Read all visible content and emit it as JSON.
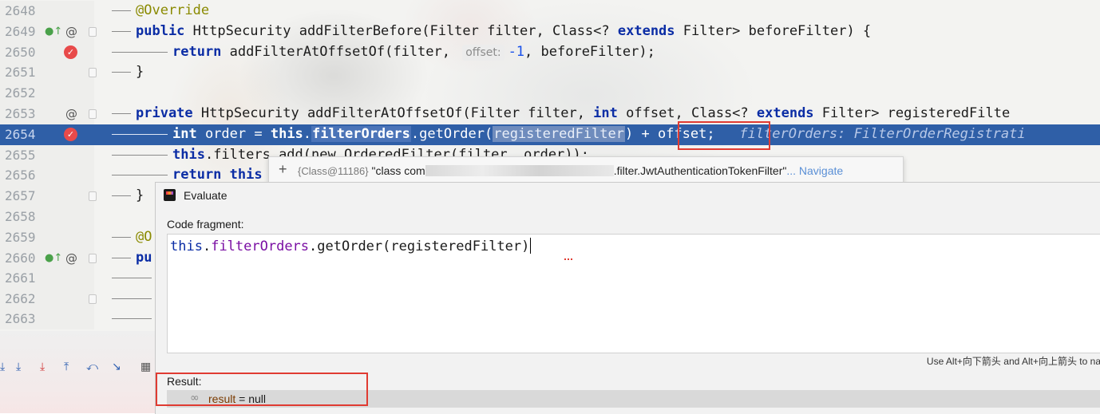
{
  "editor": {
    "lines": [
      {
        "num": "2648"
      },
      {
        "num": "2649",
        "override_marker": true,
        "at_marker": true
      },
      {
        "num": "2650",
        "breakpoint": true
      },
      {
        "num": "2651"
      },
      {
        "num": "2652"
      },
      {
        "num": "2653",
        "at_marker": true
      },
      {
        "num": "2654",
        "breakpoint": true,
        "selected": true
      },
      {
        "num": "2655"
      },
      {
        "num": "2656"
      },
      {
        "num": "2657"
      },
      {
        "num": "2658"
      },
      {
        "num": "2659"
      },
      {
        "num": "2660",
        "override_marker": true,
        "at_marker": true
      },
      {
        "num": "2661"
      },
      {
        "num": "2662"
      },
      {
        "num": "2663"
      }
    ],
    "code": {
      "l2648_ann": "@Override",
      "l2649_kw": "public",
      "l2649_rest": " HttpSecurity addFilterBefore(Filter filter, Class<? ",
      "l2649_kw2": "extends",
      "l2649_rest2": " Filter> beforeFilter) {",
      "l2650_kw": "return",
      "l2650_a": " addFilterAtOffsetOf(filter, ",
      "l2650_hint": "offset:",
      "l2650_num": "-1",
      "l2650_b": ", beforeFilter);",
      "l2651": "}",
      "l2653_kw": "private",
      "l2653_a": " HttpSecurity addFilterAtOffsetOf(Filter filter, ",
      "l2653_kw2": "int",
      "l2653_b": " offset, Class<? ",
      "l2653_kw3": "extends",
      "l2653_c": " Filter> registeredFilte",
      "l2654_kw": "int",
      "l2654_a": " order = ",
      "l2654_this": "this",
      "l2654_dot": ".",
      "l2654_field": "filterOrders",
      "l2654_call": ".getOrder(",
      "l2654_arg": "registeredFilter",
      "l2654_close": ")",
      "l2654_plus": " + offset;",
      "l2654_inline": "filterOrders: FilterOrderRegistrati",
      "l2655_kw": "this",
      "l2655_a": ".filters.add(new OrderedFilter(filter, order));",
      "l2656_kw": "return",
      "l2656_a": " this",
      "l2657": "}",
      "l2659_ann": "@O",
      "l2660_kw": "pu"
    }
  },
  "tooltip": {
    "id": "{Class@11186}",
    "text_prefix": "\"class com",
    "text_suffix": ".filter.JwtAuthenticationTokenFilter\"",
    "ellipsis": "...",
    "navigate": "Navigate"
  },
  "evaluate": {
    "title": "Evaluate",
    "code_label": "Code fragment:",
    "code_this": "this",
    "code_dot": ".",
    "code_field": "filterOrders",
    "code_call": ".getOrder(registeredFilter)",
    "hint": "Use Alt+向下箭头 and Alt+向上箭头 to na",
    "result_label": "Result:",
    "result_name": "result",
    "result_value": " = null"
  },
  "colors": {
    "selection": "#2f5fa7",
    "keyword": "#0b2da5",
    "annotation": "#8a8a00",
    "highlight_box": "#e03b32",
    "breakpoint": "#e84a4a"
  }
}
